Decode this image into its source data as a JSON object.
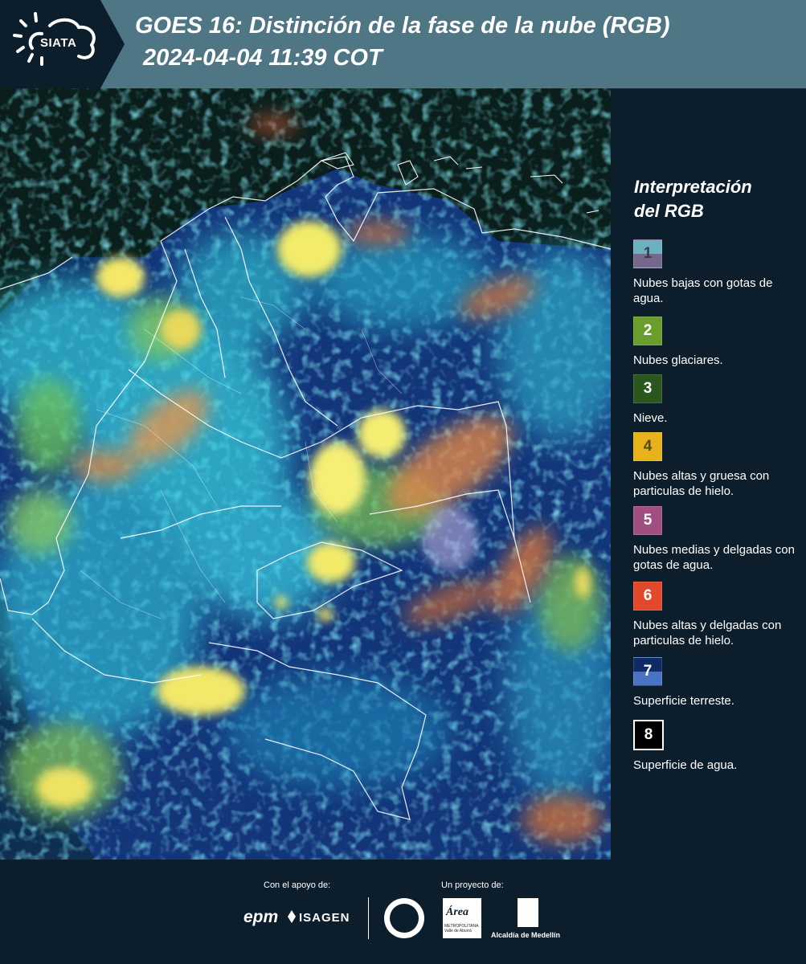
{
  "header": {
    "logo_text": "SIATA",
    "title_line1": "GOES 16: Distinción de la fase de la nube (RGB)",
    "title_line2": "2024-04-04 11:39 COT"
  },
  "legend": {
    "title_line1": "Interpretación",
    "title_line2": "del RGB",
    "items": [
      {
        "number": "1",
        "label": "Nubes bajas con gotas de agua.",
        "color_top": "#6bb1bf",
        "color_bottom": "#76688a"
      },
      {
        "number": "2",
        "label": "Nubes glaciares.",
        "color_top": "#6a9e2c",
        "color_bottom": "#6a9e2c"
      },
      {
        "number": "3",
        "label": "Nieve.",
        "color_top": "#2b561d",
        "color_bottom": "#2b561d"
      },
      {
        "number": "4",
        "label": "Nubes altas y gruesa con particulas de hielo.",
        "color_top": "#e6b31c",
        "color_bottom": "#e6b31c"
      },
      {
        "number": "5",
        "label": "Nubes medias y delgadas con gotas de agua.",
        "color_top": "#a04f83",
        "color_bottom": "#a04f83"
      },
      {
        "number": "6",
        "label": "Nubes altas y delgadas con particulas de hielo.",
        "color_top": "#e2482c",
        "color_bottom": "#e2482c"
      },
      {
        "number": "7",
        "label": "Superficie terreste.",
        "color_top": "#102a66",
        "color_bottom": "#4a74c2"
      },
      {
        "number": "8",
        "label": "Superficie de agua.",
        "color_top": "#000000",
        "color_bottom": "#000000"
      }
    ]
  },
  "footer": {
    "support_label": "Con el apoyo de:",
    "project_label": "Un proyecto de:",
    "epm": "epm",
    "isagen": "ISAGEN",
    "area_word": "Área",
    "area_sub": "METROPOLITANA Valle de Aburrá",
    "alcaldia": "Alcaldía de Medellín"
  }
}
